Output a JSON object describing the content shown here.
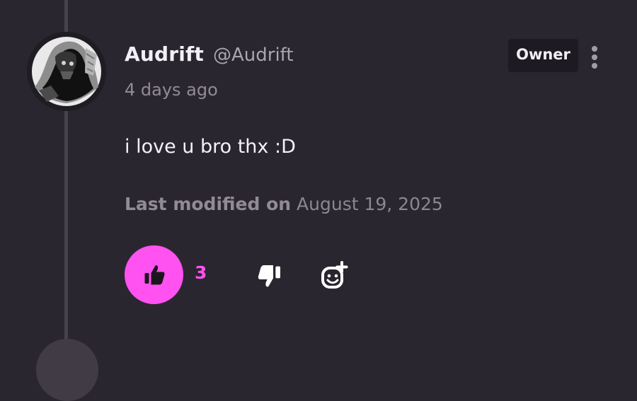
{
  "comment": {
    "author_name": "Audrift",
    "author_handle": "@Audrift",
    "timestamp": "4 days ago",
    "badge": "Owner",
    "text": "i love u bro thx :D",
    "modified_label": "Last modified on",
    "modified_date": "August 19, 2025",
    "like_count": "3"
  },
  "colors": {
    "background": "#2a2630",
    "accent": "#ff52f1",
    "text_primary": "#f2f0f4",
    "text_muted": "#918b97"
  },
  "icons": {
    "more": "more-vertical-icon",
    "like": "thumbs-up-icon",
    "dislike": "thumbs-down-icon",
    "react": "add-reaction-icon"
  }
}
